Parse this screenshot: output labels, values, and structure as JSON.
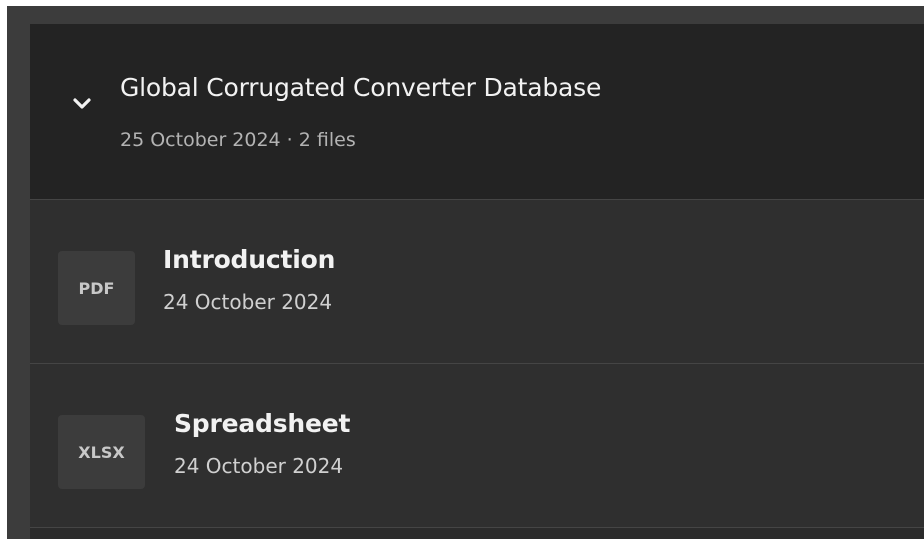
{
  "group": {
    "title": "Global Corrugated Converter Database",
    "meta": "25 October 2024 · 2 files",
    "expanded": true,
    "toggle_icon": "chevron-down-icon"
  },
  "files": [
    {
      "type": "PDF",
      "name": "Introduction",
      "date": "24 October 2024"
    },
    {
      "type": "XLSX",
      "name": "Spreadsheet",
      "date": "24 October 2024"
    }
  ],
  "colors": {
    "header_bg": "#232323",
    "row_bg": "#2f2f2f",
    "badge_bg": "#3c3c3c",
    "title_text": "#f2f2f2",
    "meta_text": "#b3b3b3"
  }
}
